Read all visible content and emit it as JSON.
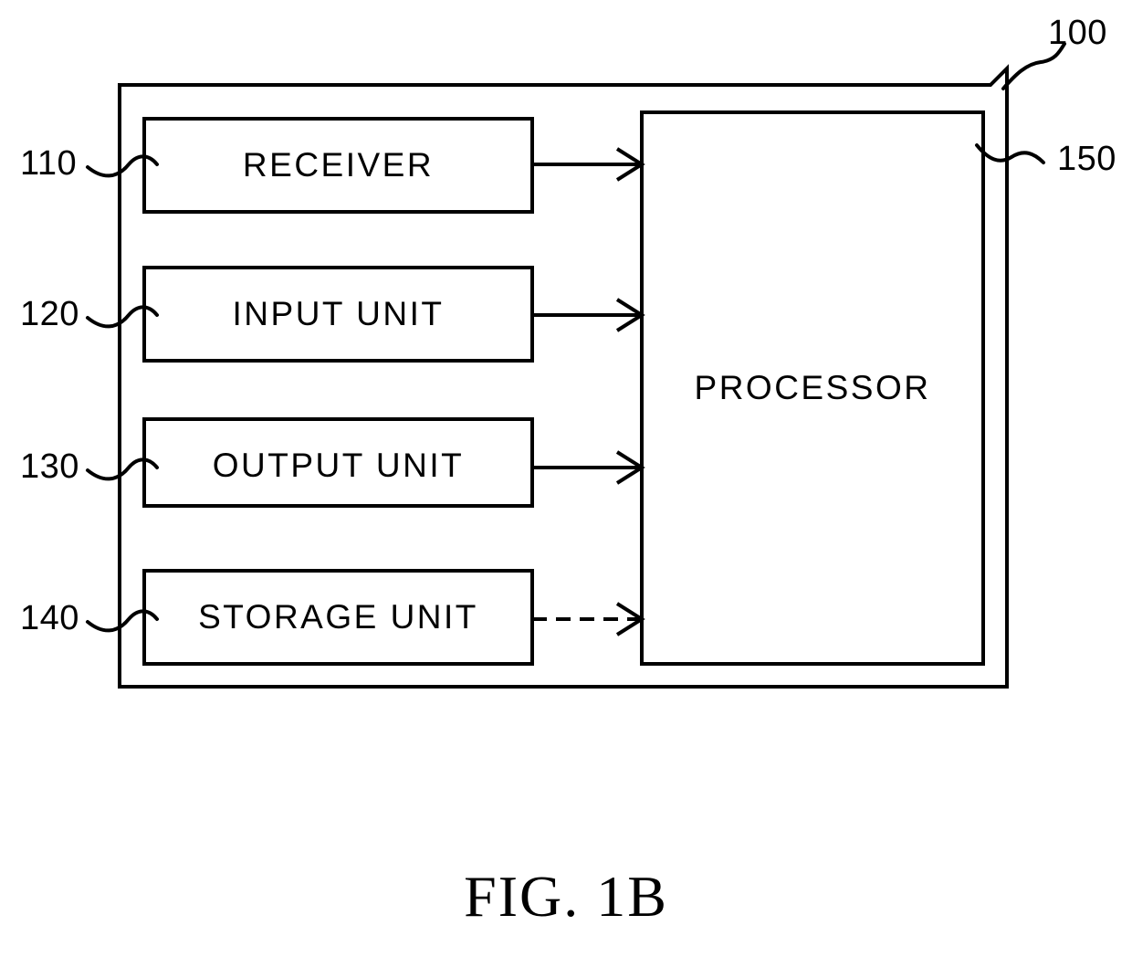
{
  "figure": {
    "caption": "FIG. 1B",
    "system_reference": "100",
    "processor_reference": "150",
    "processor_label": "PROCESSOR"
  },
  "blocks": [
    {
      "reference": "110",
      "label": "RECEIVER",
      "arrow_style": "solid"
    },
    {
      "reference": "120",
      "label": "INPUT UNIT",
      "arrow_style": "solid"
    },
    {
      "reference": "130",
      "label": "OUTPUT UNIT",
      "arrow_style": "solid"
    },
    {
      "reference": "140",
      "label": "STORAGE UNIT",
      "arrow_style": "dashed"
    }
  ],
  "colors": {
    "stroke": "#000000",
    "background": "#ffffff"
  }
}
